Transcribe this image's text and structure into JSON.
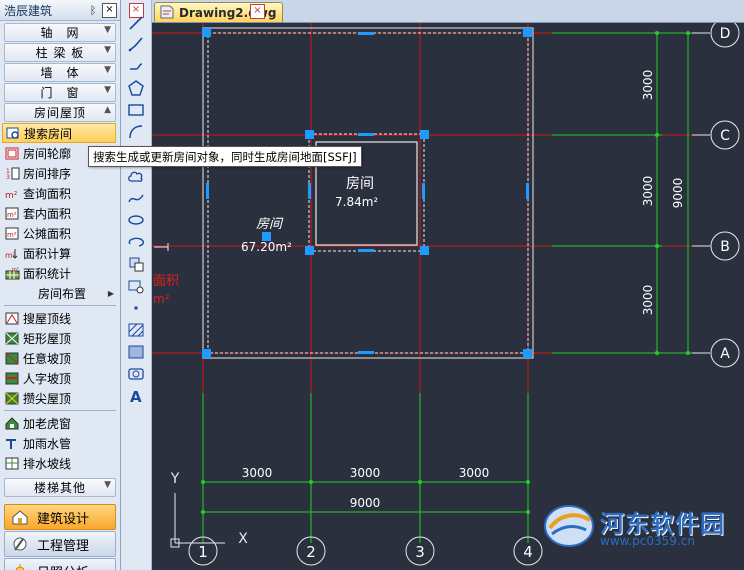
{
  "palette": {
    "title": "浩辰建筑",
    "pin": "ᛒ",
    "close": "×",
    "categories": [
      {
        "label": "轴　网"
      },
      {
        "label": "柱 梁 板"
      },
      {
        "label": "墙　体"
      },
      {
        "label": "门　窗"
      },
      {
        "label": "房间屋顶"
      }
    ],
    "items": [
      {
        "label": "搜索房间",
        "icon": "search-room-icon"
      },
      {
        "label": "房间轮廓",
        "icon": "room-outline-icon"
      },
      {
        "label": "房间排序",
        "icon": "room-sort-icon"
      },
      {
        "label": "查询面积",
        "icon": "query-area-icon"
      },
      {
        "label": "套内面积",
        "icon": "inner-area-icon"
      },
      {
        "label": "公摊面积",
        "icon": "shared-area-icon"
      },
      {
        "label": "面积计算",
        "icon": "area-calc-icon"
      },
      {
        "label": "面积统计",
        "icon": "area-stats-icon"
      },
      {
        "label": "房间布置",
        "icon": ""
      },
      {
        "label": "搜屋顶线",
        "icon": "search-roofline-icon"
      },
      {
        "label": "矩形屋顶",
        "icon": "rect-roof-icon"
      },
      {
        "label": "任意坡顶",
        "icon": "slope-roof-icon"
      },
      {
        "label": "人字坡顶",
        "icon": "gable-roof-icon"
      },
      {
        "label": "攒尖屋顶",
        "icon": "pyramid-roof-icon"
      },
      {
        "label": "加老虎窗",
        "icon": "dormer-icon"
      },
      {
        "label": "加雨水管",
        "icon": "rain-pipe-icon"
      },
      {
        "label": "排水坡线",
        "icon": "drain-slope-icon"
      }
    ],
    "stairs_category": "楼梯其他",
    "modules": [
      {
        "label": "建筑设计"
      },
      {
        "label": "工程管理"
      },
      {
        "label": "日照分析"
      }
    ]
  },
  "tab": {
    "label": "Drawing2.dwg",
    "close": "×"
  },
  "tooltip": "搜索生成或更新房间对象，同时生成房间地面[SSFJ]",
  "drawing": {
    "room_small": {
      "name": "房间",
      "area": "7.84m²"
    },
    "room_large": {
      "name": "房间",
      "area": "67.20m²"
    },
    "partial_label": {
      "text": "面积",
      "sup": "m²"
    },
    "right_dims": {
      "d1": "3000",
      "d2": "3000",
      "d3": "3000",
      "total": "9000"
    },
    "bottom_dims": {
      "d1": "3000",
      "d2": "3000",
      "d3": "3000",
      "total": "9000"
    },
    "axis_letters": [
      "D",
      "C",
      "B",
      "A"
    ],
    "axis_numbers": [
      "1",
      "2",
      "3",
      "4"
    ],
    "ucs": {
      "x": "X",
      "y": "Y"
    }
  },
  "colors": {
    "canvas_bg": "#2a303d",
    "axis_red": "#e02020",
    "dim_green": "#22d022",
    "grip_blue": "#1e9bff",
    "accent_orange": "#f9a72b"
  },
  "watermark": {
    "title": "河东软件园",
    "url": "www.pc0359.cn"
  }
}
